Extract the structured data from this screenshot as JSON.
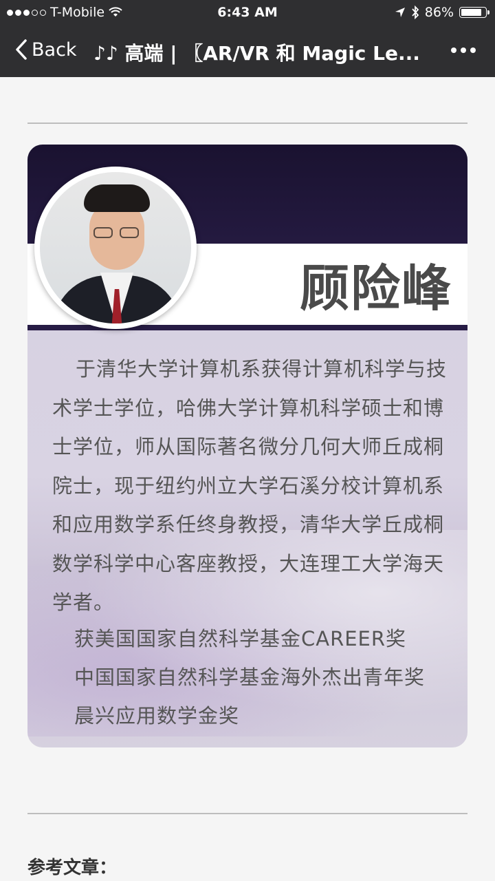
{
  "status_bar": {
    "carrier": "T-Mobile",
    "time": "6:43 AM",
    "battery": "86%",
    "battery_level": 0.86,
    "icons": [
      "wifi-icon",
      "location-arrow-icon",
      "bluetooth-icon",
      "battery-icon"
    ]
  },
  "nav": {
    "back_label": "Back",
    "title": "♪♪ 高端 | 〖AR/VR 和 Magic Le...",
    "more_icon": "more-dots-icon"
  },
  "profile": {
    "name": "顾险峰",
    "bio": "于清华大学计算机系获得计算机科学与技术学士学位，哈佛大学计算机科学硕士和博士学位，师从国际著名微分几何大师丘成桐院士，现于纽约州立大学石溪分校计算机系和应用数学系任终身教授，清华大学丘成桐数学科学中心客座教授，大连理工大学海天学者。",
    "awards": [
      "获美国国家自然科学基金CAREER奖",
      "中国国家自然科学基金海外杰出青年奖",
      "晨兴应用数学金奖"
    ]
  },
  "references": {
    "title": "参考文章："
  }
}
